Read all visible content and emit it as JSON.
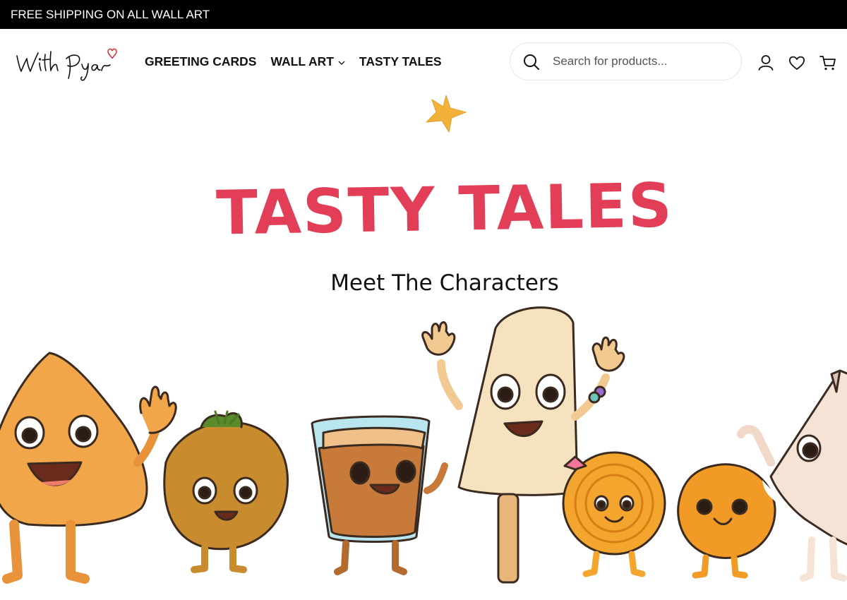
{
  "announcement": {
    "text": "FREE SHIPPING ON ALL WALL ART"
  },
  "header": {
    "logo_text": "With Pyar",
    "nav": [
      {
        "label": "GREETING CARDS",
        "has_dropdown": false
      },
      {
        "label": "WALL ART",
        "has_dropdown": true
      },
      {
        "label": "TASTY TALES",
        "has_dropdown": false
      }
    ],
    "search": {
      "placeholder": "Search for products...",
      "value": ""
    },
    "icons": [
      "user-icon",
      "heart-icon",
      "cart-icon"
    ]
  },
  "hero": {
    "title": "TASTY TALES",
    "subtitle": "Meet The Characters",
    "characters": [
      "samosa",
      "pakora",
      "chai-glass",
      "kulfi",
      "jalebi",
      "biscuit",
      "paratha"
    ]
  },
  "colors": {
    "title": "#e23e57",
    "topbar": "#000000",
    "star": "#f2b23a"
  }
}
